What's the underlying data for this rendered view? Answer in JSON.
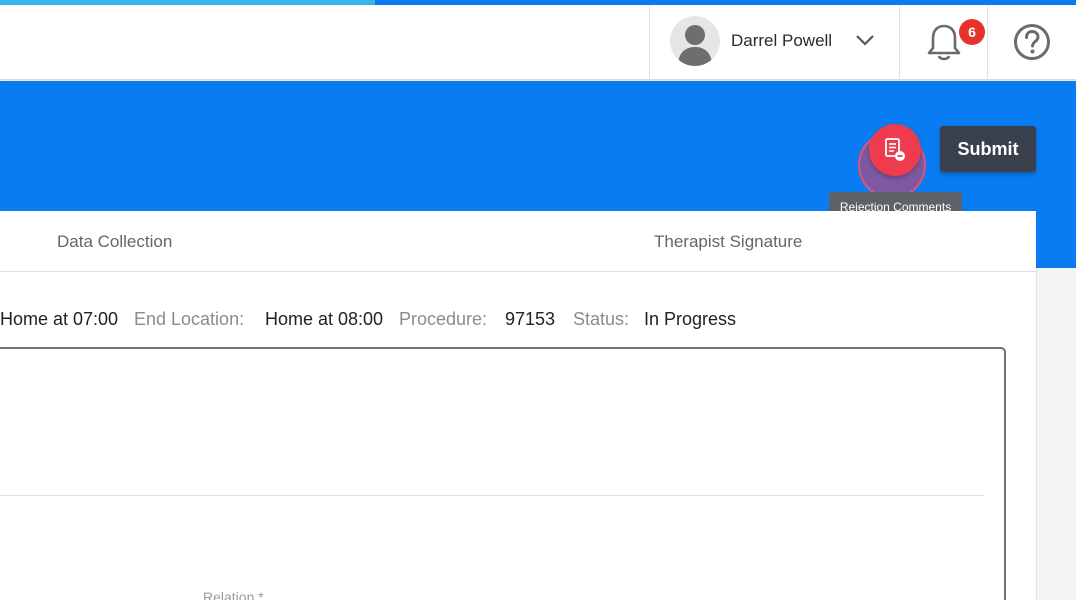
{
  "header": {
    "user_name": "Darrel Powell",
    "notification_count": "6"
  },
  "banner": {
    "rejection_tooltip": "Rejection Comments",
    "submit_label": "Submit"
  },
  "tabs": [
    {
      "label": "Data Collection"
    },
    {
      "label": "Therapist Signature"
    }
  ],
  "session_info": {
    "start_location_value": "Home at 07:00",
    "end_location_label": "End Location:",
    "end_location_value": "Home at 08:00",
    "procedure_label": "Procedure:",
    "procedure_value": "97153",
    "status_label": "Status:",
    "status_value": "In Progress"
  },
  "form": {
    "relation_label": "Relation *"
  },
  "colors": {
    "primary_blue": "#0a7cf2",
    "strip_light_blue": "#36b6ec",
    "badge_red": "#e5332c",
    "reject_red": "#ee3b4e",
    "submit_dark": "#3a3f4c"
  },
  "icons": [
    "avatar",
    "chevron-down-icon",
    "bell-icon",
    "help-icon",
    "rejection-comments-icon"
  ]
}
